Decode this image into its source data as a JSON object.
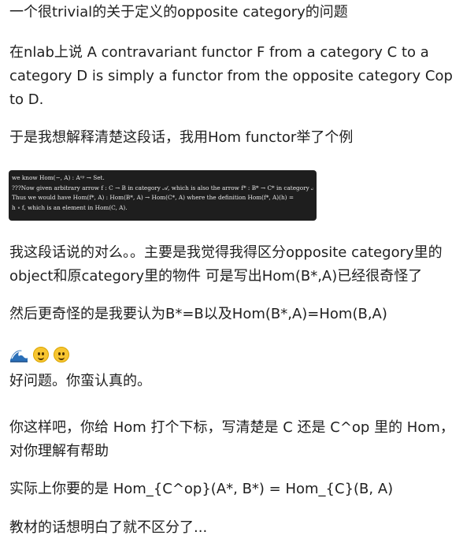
{
  "question": {
    "title": "一个很trivial的关于定义的opposite category的问题",
    "nlab_quote": "在nlab上说 A contravariant functor F from a category C to a category D is simply a functor from the opposite category Cop to D.",
    "intro": "于是我想解释清楚这段话，我用Hom functor举了个例",
    "snippet_lines": [
      "we know Hom(−, A) : Aᵒᵖ → Set.",
      "???Now given arbitrary arrow f : C → B in category 𝒜, which is also the arrow f* : B* → C* in category 𝒜ᵒᵖ.",
      "Thus we would have Hom(f*, A) : Hom(B*, A) → Hom(C*, A) where the definition Hom(f*, A)(h) =",
      "h ∘ f, which is an element in Hom(C, A)."
    ],
    "followup": "我这段话说的对么。。主要是我觉得我得区分opposite category里的object和原category里的物件 可是写出Hom(B*,A)已经很奇怪了",
    "stranger": "然后更奇怪的是我要认为B*=B以及Hom(B*,A)=Hom(B,A)"
  },
  "reply": {
    "emoji_icons": [
      "wave-emoji",
      "smile-emoji",
      "smile-emoji"
    ],
    "good_question": "好问题。你蛮认真的。",
    "suggestion": "你这样吧，你给 Hom 打个下标，写清楚是 C 还是 C^op 里的 Hom，对你理解有帮助",
    "actually": "实际上你要的是 Hom_{C^op}(A*, B*) = Hom_{C}(B, A)",
    "textbook": "教材的话想明白了就不区分了..."
  }
}
